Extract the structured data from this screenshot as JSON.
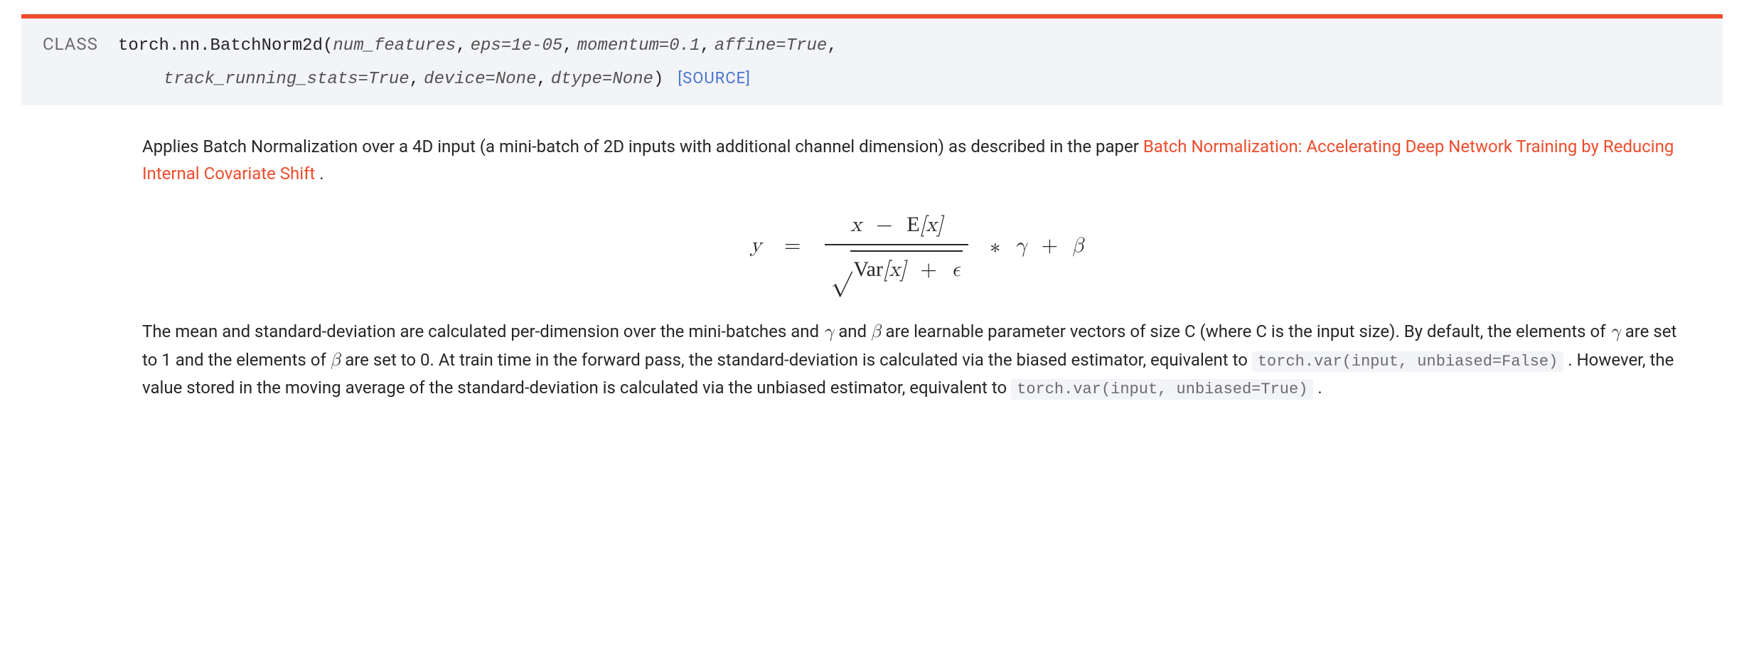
{
  "signature": {
    "class_badge": "CLASS",
    "qualified_name": "torch.nn.BatchNorm2d",
    "open_paren": "(",
    "close_paren": ")",
    "params": [
      "num_features",
      "eps=1e-05",
      "momentum=0.1",
      "affine=True",
      "track_running_stats=True",
      "device=None",
      "dtype=None"
    ],
    "source_link": "[SOURCE]"
  },
  "description": {
    "para1_before_link": "Applies Batch Normalization over a 4D input (a mini-batch of 2D inputs with additional channel dimension) as described in the paper ",
    "paper_link_text": "Batch Normalization: Accelerating Deep Network Training by Reducing Internal Covariate Shift ",
    "para1_after_link": "."
  },
  "formula": {
    "lhs": "y",
    "eq": "=",
    "numerator_x": "x",
    "minus": "−",
    "E": "E",
    "bracket_x": "[x]",
    "Var": "Var",
    "plus": "+",
    "epsilon": "ϵ",
    "star": "∗",
    "gamma": "γ",
    "beta": "β"
  },
  "para2": {
    "t1": "The mean and standard-deviation are calculated per-dimension over the mini-batches and ",
    "sym_gamma": "γ",
    "t2": " and ",
    "sym_beta": "β",
    "t3": " are learnable parameter vectors of size C (where C is the input size). By default, the elements of ",
    "t4": " are set to 1 and the elements of ",
    "t5": " are set to 0. At train time in the forward pass, the standard-deviation is calculated via the biased estimator, equivalent to ",
    "code1": "torch.var(input, unbiased=False)",
    "t6": " . However, the value stored in the moving average of the standard-deviation is calculated via the unbiased estimator, equivalent to ",
    "code2": "torch.var(input, unbiased=True)",
    "t7": " ."
  }
}
